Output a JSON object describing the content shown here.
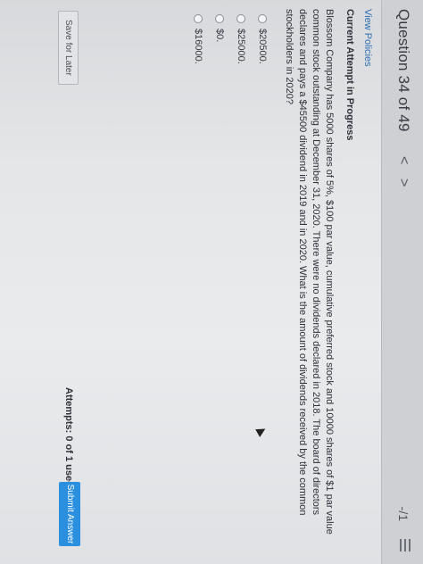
{
  "header": {
    "question_label": "Question 34 of 49",
    "prev_symbol": "<",
    "next_symbol": ">",
    "score": "-/1"
  },
  "links": {
    "view_policies": "View Policies"
  },
  "attempt_heading": "Current Attempt in Progress",
  "question_text": "Blossom Company has 5000 shares of 5%, $100 par value, cumulative preferred stock and 10000 shares of $1 par value common stock outstanding at December 31, 2020. There were no dividends declared in 2018. The board of directors declares and pays a $45500 dividend in 2019 and in 2020. What is the amount of dividends received by the common stockholders in 2020?",
  "options": [
    {
      "label": "$20500."
    },
    {
      "label": "$25000."
    },
    {
      "label": "$0."
    },
    {
      "label": "$16000."
    }
  ],
  "footer": {
    "save_label": "Save for Later",
    "attempts_text": "Attempts: 0 of 1 used",
    "submit_label": "Submit Answer"
  },
  "colors": {
    "link": "#2f6fb4",
    "submit_button": "#2b8fe0"
  },
  "icons": {
    "menu": "list-icon"
  }
}
